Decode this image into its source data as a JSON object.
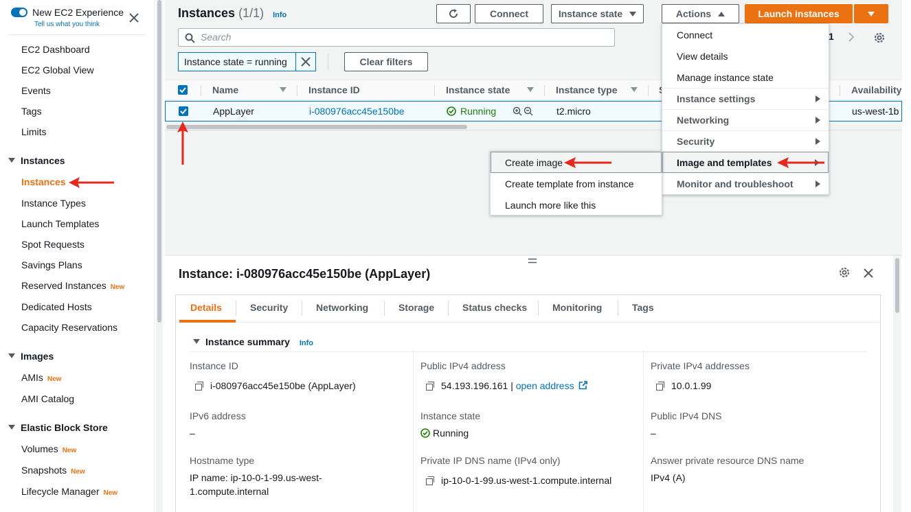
{
  "sidebar": {
    "experience_title": "New EC2 Experience",
    "experience_sub": "Tell us what you think",
    "top_items": [
      "EC2 Dashboard",
      "EC2 Global View",
      "Events",
      "Tags",
      "Limits"
    ],
    "instances_section": "Instances",
    "instances_items": [
      "Instances",
      "Instance Types",
      "Launch Templates",
      "Spot Requests",
      "Savings Plans",
      "Reserved Instances",
      "Dedicated Hosts",
      "Capacity Reservations"
    ],
    "images_section": "Images",
    "images_items": [
      "AMIs",
      "AMI Catalog"
    ],
    "ebs_section": "Elastic Block Store",
    "ebs_items": [
      "Volumes",
      "Snapshots",
      "Lifecycle Manager"
    ],
    "new_badge": "New"
  },
  "header": {
    "title": "Instances",
    "count": "(1/1)",
    "info": "Info",
    "connect": "Connect",
    "instance_state": "Instance state",
    "actions": "Actions",
    "launch": "Launch instances",
    "page_number": "1"
  },
  "search": {
    "placeholder": "Search"
  },
  "filter": {
    "chip": "Instance state = running",
    "clear": "Clear filters"
  },
  "table": {
    "columns": [
      "Name",
      "Instance ID",
      "Instance state",
      "Instance type",
      "S",
      "Availability"
    ],
    "row": {
      "name": "AppLayer",
      "id": "i-080976acc45e150be",
      "state": "Running",
      "type": "t2.micro",
      "az": "us-west-1b"
    }
  },
  "actions_menu": [
    "Connect",
    "View details",
    "Manage instance state",
    "Instance settings",
    "Networking",
    "Security",
    "Image and templates",
    "Monitor and troubleshoot"
  ],
  "image_submenu": [
    "Create image",
    "Create template from instance",
    "Launch more like this"
  ],
  "detail": {
    "title": "Instance: i-080976acc45e150be (AppLayer)",
    "tabs": [
      "Details",
      "Security",
      "Networking",
      "Storage",
      "Status checks",
      "Monitoring",
      "Tags"
    ],
    "summary": "Instance summary",
    "info": "Info",
    "fields": {
      "instance_id_label": "Instance ID",
      "instance_id": "i-080976acc45e150be (AppLayer)",
      "public_ipv4_label": "Public IPv4 address",
      "public_ipv4": "54.193.196.161 |",
      "open_address": "open address",
      "private_ipv4_label": "Private IPv4 addresses",
      "private_ipv4": "10.0.1.99",
      "ipv6_label": "IPv6 address",
      "ipv6": "–",
      "state_label": "Instance state",
      "state": "Running",
      "public_dns_label": "Public IPv4 DNS",
      "public_dns": "–",
      "hostname_label": "Hostname type",
      "hostname_line1": "IP name: ip-10-0-1-99.us-west-",
      "hostname_line2": "1.compute.internal",
      "private_dns_label": "Private IP DNS name (IPv4 only)",
      "private_dns": "ip-10-0-1-99.us-west-1.compute.internal",
      "answer_label": "Answer private resource DNS name",
      "answer": "IPv4 (A)"
    }
  },
  "colors": {
    "accent": "#ec7211",
    "link": "#0073bb",
    "success": "#1d8102",
    "annotation": "#e8261c"
  }
}
